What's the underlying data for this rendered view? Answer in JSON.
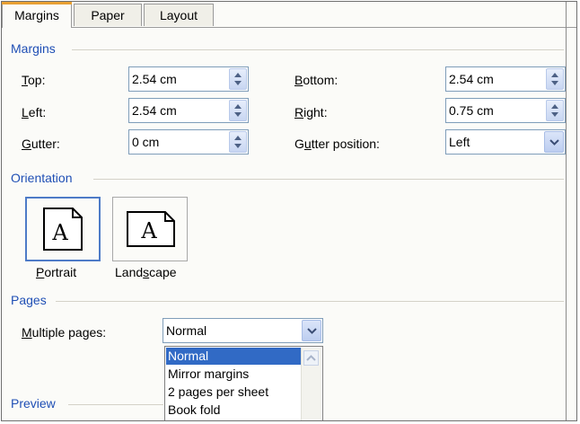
{
  "tabs": [
    {
      "label": "Margins"
    },
    {
      "label": "Paper"
    },
    {
      "label": "Layout"
    }
  ],
  "margins": {
    "header": "Margins",
    "top": {
      "label": "Top:",
      "value": "2.54 cm"
    },
    "left": {
      "label": "Left:",
      "value": "2.54 cm"
    },
    "gutter": {
      "label": "Gutter:",
      "value": "0 cm"
    },
    "bottom": {
      "label": "Bottom:",
      "value": "2.54 cm"
    },
    "right": {
      "label": "Right:",
      "value": "0.75 cm"
    },
    "gutter_position": {
      "label": "Gutter position:",
      "value": "Left"
    }
  },
  "orientation": {
    "header": "Orientation",
    "portrait": {
      "label": "Portrait",
      "icon": "portrait-page-icon",
      "glyph": "A"
    },
    "landscape": {
      "label": "Landscape",
      "icon": "landscape-page-icon",
      "glyph": "A"
    },
    "selected": "portrait"
  },
  "pages": {
    "header": "Pages",
    "multiple_pages": {
      "label": "Multiple pages:",
      "value": "Normal",
      "options": [
        "Normal",
        "Mirror margins",
        "2 pages per sheet",
        "Book fold"
      ]
    }
  },
  "preview": {
    "header": "Preview"
  },
  "colors": {
    "accent_header": "#1f4fb5",
    "selection": "#316ac5",
    "tab_highlight": "#e8a033"
  }
}
